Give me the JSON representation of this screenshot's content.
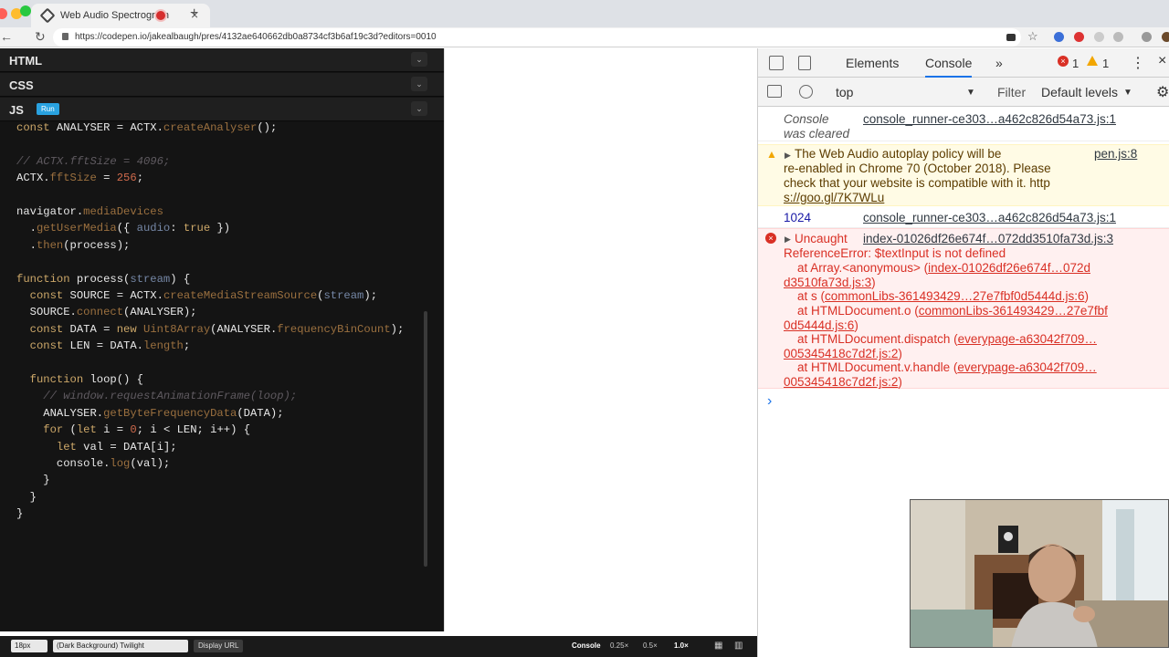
{
  "browser": {
    "tab_title": "Web Audio Spectrogram",
    "url": "https://codepen.io/jakealbaugh/pres/4132ae640662db0a8734cf3b6af19c3d?editors=0010"
  },
  "editor": {
    "panels": {
      "html": "HTML",
      "css": "CSS",
      "js": "JS"
    },
    "run_label": "Run",
    "code_lines": [
      "const ANALYSER = ACTX.createAnalyser();",
      "",
      "// ACTX.fftSize = 4096;",
      "ACTX.fftSize = 256;",
      "",
      "navigator.mediaDevices",
      "  .getUserMedia({ audio: true })",
      "  .then(process);",
      "",
      "function process(stream) {",
      "  const SOURCE = ACTX.createMediaStreamSource(stream);",
      "  SOURCE.connect(ANALYSER);",
      "  const DATA = new Uint8Array(ANALYSER.frequencyBinCount);",
      "  const LEN = DATA.length;",
      "",
      "  function loop() {",
      "    // window.requestAnimationFrame(loop);",
      "    ANALYSER.getByteFrequencyData(DATA);",
      "    for (let i = 0; i < LEN; i++) {",
      "      let val = DATA[i];",
      "      console.log(val);",
      "    }",
      "  }",
      "}"
    ]
  },
  "bottombar": {
    "font_size": "18px",
    "theme": "(Dark Background) Twilight",
    "display_url": "Display URL",
    "console": "Console",
    "zoom_options": [
      "0.25×",
      "0.5×",
      "1.0×"
    ]
  },
  "devtools": {
    "tabs": [
      "Elements",
      "Console"
    ],
    "more": "»",
    "error_count": "1",
    "warning_count": "1",
    "context": "top",
    "filter_placeholder": "Filter",
    "levels": "Default levels",
    "messages": {
      "cleared": {
        "text_1": "Console",
        "text_2": "was cleared",
        "src": "console_runner-ce303…a462c826d54a73.js:1"
      },
      "warning": {
        "line_1": "The Web Audio autoplay policy will be",
        "src": "pen.js:8",
        "line_2": "re-enabled in Chrome 70 (October 2018). Please",
        "line_3": "check that your website is compatible with it. http",
        "line_4": "s://goo.gl/7K7WLu"
      },
      "log": {
        "value": "1024",
        "src": "console_runner-ce303…a462c826d54a73.js:1"
      },
      "error": {
        "title": "Uncaught",
        "src": "index-01026df26e674f…072dd3510fa73d.js:3",
        "line_2": "ReferenceError: $textInput is not defined",
        "stack": [
          {
            "at": "    at Array.<anonymous> (",
            "link": "index-01026df26e674f…072d",
            "cont": "d3510fa73d.js:3",
            "end": ")"
          },
          {
            "at": "    at s (",
            "link": "commonLibs-361493429…27e7fbf0d5444d.js:6",
            "cont": "",
            "end": ")"
          },
          {
            "at": "    at HTMLDocument.o (",
            "link": "commonLibs-361493429…27e7fbf",
            "cont": "0d5444d.js:6",
            "end": ")"
          },
          {
            "at": "    at HTMLDocument.dispatch (",
            "link": "everypage-a63042f709…",
            "cont": "005345418c7d2f.js:2",
            "end": ")"
          },
          {
            "at": "    at HTMLDocument.v.handle (",
            "link": "everypage-a63042f709…",
            "cont": "005345418c7d2f.js:2",
            "end": ")"
          }
        ]
      },
      "prompt": "›"
    }
  }
}
